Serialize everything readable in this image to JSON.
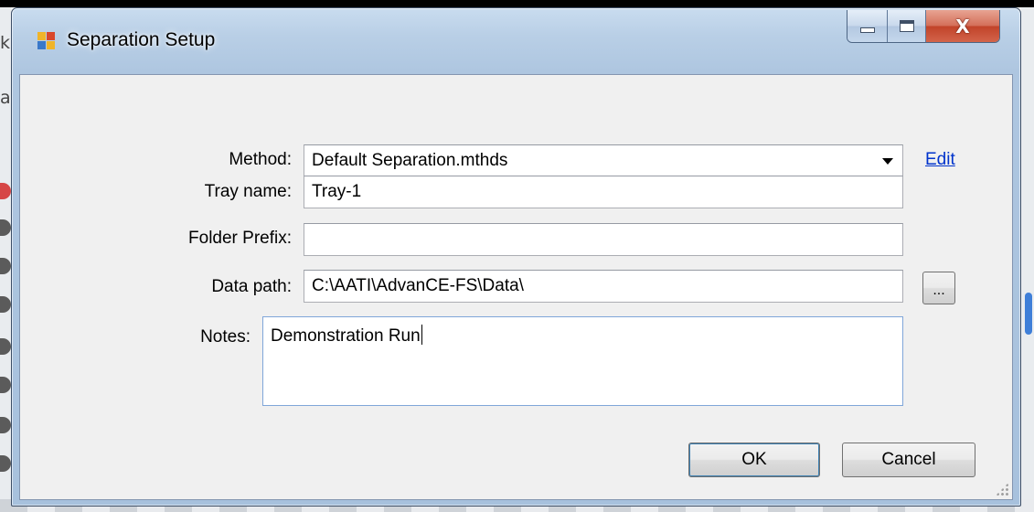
{
  "window": {
    "title": "Separation Setup",
    "close_symbol": "X"
  },
  "form": {
    "method": {
      "label": "Method:",
      "selected_value": "Default Separation.mthds",
      "edit_link": "Edit"
    },
    "tray_name": {
      "label": "Tray name:",
      "value": "Tray-1"
    },
    "folder_prefix": {
      "label": "Folder Prefix:",
      "value": ""
    },
    "data_path": {
      "label": "Data path:",
      "value": "C:\\AATI\\AdvanCE-FS\\Data\\",
      "browse_label": "..."
    },
    "notes": {
      "label": "Notes:",
      "value": "Demonstration Run"
    }
  },
  "buttons": {
    "ok": "OK",
    "cancel": "Cancel"
  },
  "icons": {
    "app": "app-window-icon",
    "minimize": "minimize-icon",
    "maximize": "maximize-icon",
    "close": "close-icon",
    "dropdown": "chevron-down-icon",
    "resize": "resize-grip-icon"
  },
  "colors": {
    "titlebar": "#b9cfe6",
    "close_button": "#c2432a",
    "link": "#0033cc",
    "client_background": "#f0f0f0"
  }
}
